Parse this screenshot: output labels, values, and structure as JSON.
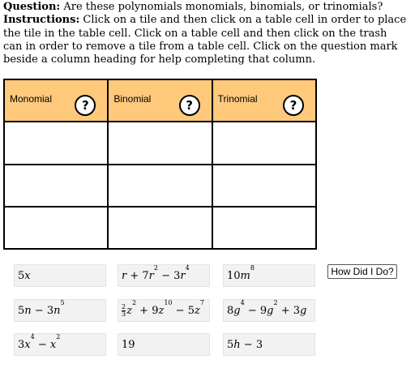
{
  "question": {
    "label": "Question:",
    "text": " Are these polynomials monomials, binomials, or trinomials?",
    "instructions_label": "Instructions:",
    "instructions_text": " Click on a tile and then click on a table cell in order to place the tile in the table cell. Click on a table cell and then click on the trash can in order to remove a tile from a table cell. Click on the question mark beside a column heading for help completing that column."
  },
  "table": {
    "headers": [
      "Monomial",
      "Binomial",
      "Trinomial"
    ],
    "help_symbol": "?"
  },
  "tiles": {
    "t1": {
      "a": "5",
      "b": "x"
    },
    "t2": {
      "a": "r",
      "b": " + 7",
      "c": "r",
      "d": "2",
      "e": " − 3",
      "f": "r",
      "g": "4"
    },
    "t3": {
      "a": "10",
      "b": "m",
      "c": "8"
    },
    "t4": {
      "a": "5",
      "b": "n",
      "c": " − 3",
      "d": "n",
      "e": "5"
    },
    "t5": {
      "num": "2",
      "den": "3",
      "a": "z",
      "b": "2",
      "c": " + 9",
      "d": "z",
      "e": "10",
      "f": " − 5",
      "g": "z",
      "h": "7"
    },
    "t6": {
      "a": "8",
      "b": "g",
      "c": "4",
      "d": " − 9",
      "e": "g",
      "f": "2",
      "g": " + 3",
      "h": "g"
    },
    "t7": {
      "a": "3",
      "b": "x",
      "c": "4",
      "d": " − ",
      "e": "x",
      "f": "2"
    },
    "t8": {
      "a": "19"
    },
    "t9": {
      "a": "5",
      "b": "h",
      "c": " − 3"
    }
  },
  "how_button": "How Did I Do?"
}
